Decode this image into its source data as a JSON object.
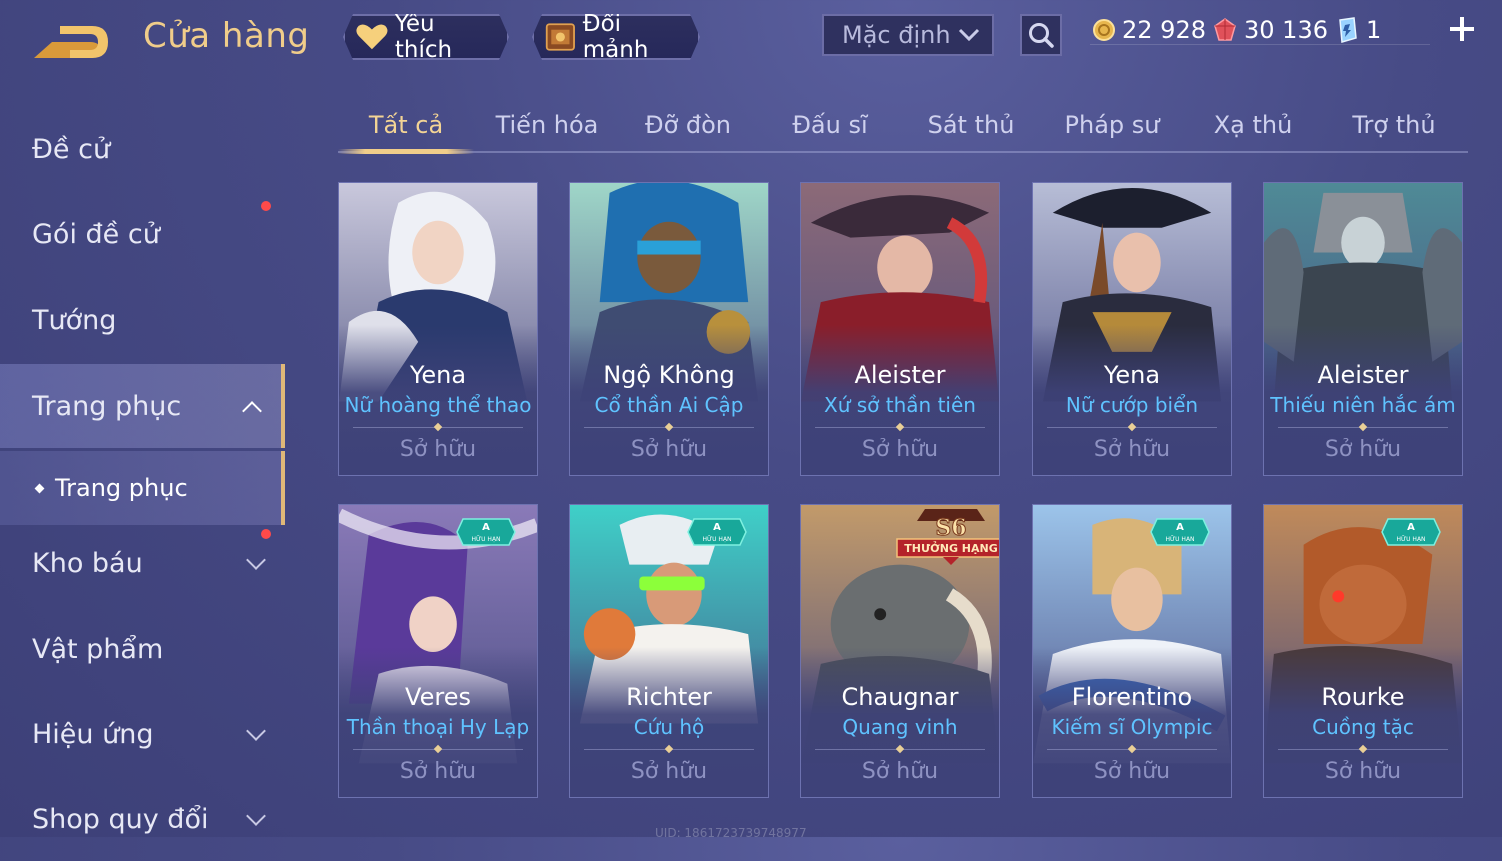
{
  "header": {
    "title": "Cửa hàng",
    "favorite_label": "Yêu thích",
    "shard_label": "Đổi mảnh",
    "sort": {
      "selected": "Mặc định"
    },
    "currencies": {
      "gold": "22 928",
      "ruby": "30 136",
      "voucher": "1"
    }
  },
  "sidebar": {
    "items": [
      {
        "label": "Đề cử"
      },
      {
        "label": "Gói đề cử"
      },
      {
        "label": "Tướng"
      },
      {
        "label": "Trang phục"
      },
      {
        "label": "Trang phục"
      },
      {
        "label": "Kho báu"
      },
      {
        "label": "Vật phẩm"
      },
      {
        "label": "Hiệu ứng"
      },
      {
        "label": "Shop quy đổi"
      }
    ]
  },
  "tabs": [
    {
      "label": "Tất cả"
    },
    {
      "label": "Tiến hóa"
    },
    {
      "label": "Đỡ đòn"
    },
    {
      "label": "Đấu sĩ"
    },
    {
      "label": "Sát thủ"
    },
    {
      "label": "Pháp sư"
    },
    {
      "label": "Xạ thủ"
    },
    {
      "label": "Trợ thủ"
    }
  ],
  "cards": [
    {
      "hero": "Yena",
      "skin": "Nữ hoàng thể thao",
      "status": "Sở hữu"
    },
    {
      "hero": "Ngộ Không",
      "skin": "Cổ thần Ai Cập",
      "status": "Sở hữu"
    },
    {
      "hero": "Aleister",
      "skin": "Xứ sở thần tiên",
      "status": "Sở hữu"
    },
    {
      "hero": "Yena",
      "skin": "Nữ cướp biển",
      "status": "Sở hữu"
    },
    {
      "hero": "Aleister",
      "skin": "Thiếu niên hắc ám",
      "status": "Sở hữu"
    },
    {
      "hero": "Veres",
      "skin": "Thần thoại Hy Lạp",
      "status": "Sở hữu",
      "badge_title": "A",
      "badge_sub": "HỮU HẠN"
    },
    {
      "hero": "Richter",
      "skin": "Cứu hộ",
      "status": "Sở hữu",
      "badge_title": "A",
      "badge_sub": "HỮU HẠN"
    },
    {
      "hero": "Chaugnar",
      "skin": "Quang vinh",
      "status": "Sở hữu",
      "badge_title": "S6",
      "badge_sub": "THƯỞNG HẠNG"
    },
    {
      "hero": "Florentino",
      "skin": "Kiếm sĩ Olympic",
      "status": "Sở hữu",
      "badge_title": "A",
      "badge_sub": "HỮU HẠN"
    },
    {
      "hero": "Rourke",
      "skin": "Cuồng tặc",
      "status": "Sở hữu",
      "badge_title": "A",
      "badge_sub": "HỮU HẠN"
    }
  ],
  "watermark": "UID: 1861723739748977",
  "colors": {
    "accent_gold": "#f0cd8a",
    "skin_blue": "#5fc3ff",
    "owned_gray": "#8e92c2",
    "notify_red": "#ff4a4a"
  }
}
